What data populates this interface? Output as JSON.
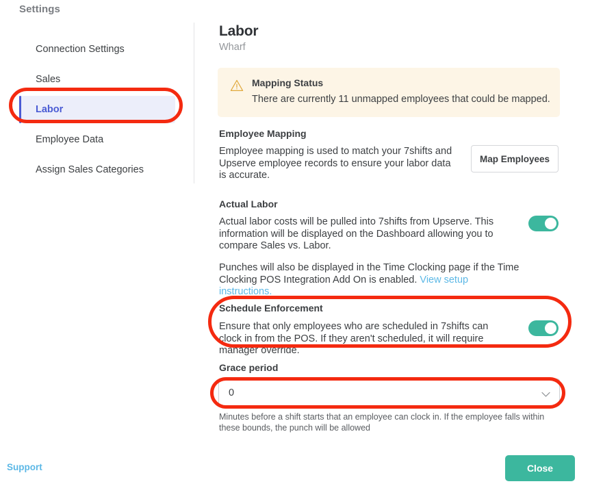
{
  "sidebar": {
    "title": "Settings",
    "items": [
      {
        "label": "Connection Settings",
        "active": false
      },
      {
        "label": "Sales",
        "active": false
      },
      {
        "label": "Labor",
        "active": true
      },
      {
        "label": "Employee Data",
        "active": false
      },
      {
        "label": "Assign Sales Categories",
        "active": false
      }
    ]
  },
  "main": {
    "title": "Labor",
    "subtitle": "Wharf",
    "alert": {
      "icon": "warning-triangle-icon",
      "heading": "Mapping Status",
      "body": "There are currently 11 unmapped employees that could be mapped.",
      "unmapped_count": "11",
      "background": "#fdf5e6",
      "icon_color": "#e0a83a"
    },
    "employee_mapping": {
      "heading": "Employee Mapping",
      "description": "Employee mapping is used to match your 7shifts and Upserve employee records to ensure your labor data is accurate.",
      "button_label": "Map Employees"
    },
    "actual_labor": {
      "heading": "Actual Labor",
      "description": "Actual labor costs will be pulled into 7shifts from Upserve. This information will be displayed on the Dashboard allowing you to compare Sales vs. Labor.",
      "punches_text": "Punches will also be displayed in the Time Clocking page if the Time Clocking POS Integration Add On is enabled. ",
      "setup_link_label": "View setup instructions.",
      "toggle_state": "on"
    },
    "schedule_enforcement": {
      "heading": "Schedule Enforcement",
      "description": "Ensure that only employees who are scheduled in 7shifts can clock in from the POS. If they aren't scheduled, it will require manager override.",
      "toggle_state": "on"
    },
    "grace_period": {
      "heading": "Grace period",
      "value": "0",
      "chevron_icon": "chevron-down-icon",
      "helper_text": "Minutes before a shift starts that an employee can clock in. If the employee falls within these bounds, the punch will be allowed"
    }
  },
  "footer": {
    "support_label": "Support",
    "close_label": "Close"
  },
  "annotations": {
    "color": "#f42a10",
    "targets": [
      "sidebar-item-labor",
      "schedule-enforcement-section",
      "grace-period-select"
    ]
  },
  "colors": {
    "accent_teal": "#3cb79e",
    "link_blue": "#5cb8e6",
    "active_nav": "#4a5bd4",
    "active_nav_bg": "#eceefa",
    "annotation_red": "#f42a10"
  }
}
